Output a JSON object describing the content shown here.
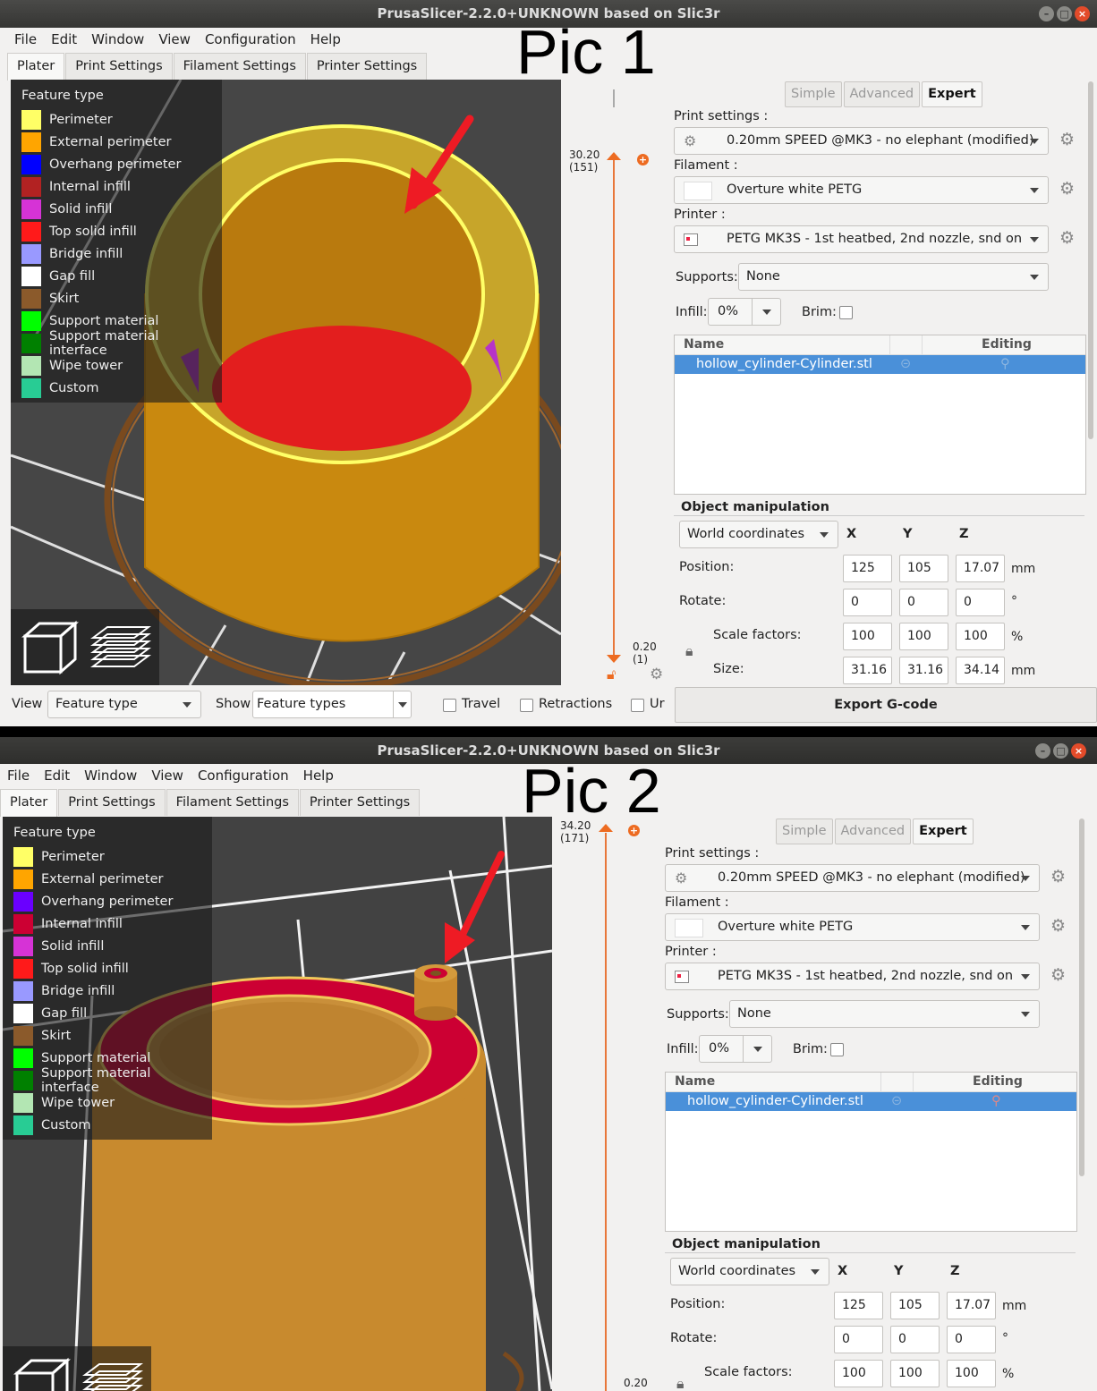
{
  "window": {
    "title": "PrusaSlicer-2.2.0+UNKNOWN based on Slic3r"
  },
  "menu": [
    "File",
    "Edit",
    "Window",
    "View",
    "Configuration",
    "Help"
  ],
  "tabs": [
    "Plater",
    "Print Settings",
    "Filament Settings",
    "Printer Settings"
  ],
  "pic_labels": {
    "pic1": "Pic 1",
    "pic2": "Pic 2"
  },
  "legend": {
    "title": "Feature type",
    "items": [
      {
        "label": "Perimeter",
        "color": "#ffff66"
      },
      {
        "label": "External perimeter",
        "color": "#ffa500"
      },
      {
        "label": "Overhang perimeter",
        "color": "#0000ff"
      },
      {
        "label": "Internal infill",
        "color": "#b22222"
      },
      {
        "label": "Solid infill",
        "color": "#d633d6"
      },
      {
        "label": "Top solid infill",
        "color": "#ff1a1a"
      },
      {
        "label": "Bridge infill",
        "color": "#9999ff"
      },
      {
        "label": "Gap fill",
        "color": "#ffffff"
      },
      {
        "label": "Skirt",
        "color": "#8b5a2b"
      },
      {
        "label": "Support material",
        "color": "#00ff00"
      },
      {
        "label": "Support material interface",
        "color": "#008000"
      },
      {
        "label": "Wipe tower",
        "color": "#b3e6b3"
      },
      {
        "label": "Custom",
        "color": "#28cc94"
      }
    ],
    "pic2_colors": {
      "overhang": "#6a00ff",
      "internal_infill": "#cc0033"
    }
  },
  "slider": {
    "pic1": {
      "top_value": "30.20",
      "top_layer": "(151)",
      "bottom_value": "0.20",
      "bottom_layer": "(1)"
    },
    "pic2": {
      "top_value": "34.20",
      "top_layer": "(171)",
      "bottom_value": "0.20"
    }
  },
  "modes": {
    "simple": "Simple",
    "advanced": "Advanced",
    "expert": "Expert"
  },
  "settings": {
    "print_label": "Print settings :",
    "print_value": "0.20mm SPEED @MK3 - no elephant (modified)",
    "filament_label": "Filament :",
    "filament_value": "Overture white PETG",
    "printer_label": "Printer :",
    "printer_value": "PETG MK3S - 1st heatbed, 2nd nozzle, snd on",
    "supports_label": "Supports:",
    "supports_value": "None",
    "infill_label": "Infill:",
    "infill_value": "0%",
    "brim_label": "Brim:"
  },
  "object_list": {
    "col_name": "Name",
    "col_editing": "Editing",
    "item": "hollow_cylinder-Cylinder.stl"
  },
  "manipulation": {
    "title": "Object manipulation",
    "coord_system": "World coordinates",
    "axes": [
      "X",
      "Y",
      "Z"
    ],
    "position_label": "Position:",
    "position": [
      "125",
      "105",
      "17.07"
    ],
    "position_unit": "mm",
    "rotate_label": "Rotate:",
    "rotate": [
      "0",
      "0",
      "0"
    ],
    "rotate_unit": "°",
    "scale_label": "Scale factors:",
    "scale": [
      "100",
      "100",
      "100"
    ],
    "scale_unit": "%",
    "size_label": "Size:",
    "size": [
      "31.16",
      "31.16",
      "34.14"
    ],
    "size_unit": "mm"
  },
  "bottom": {
    "view_label": "View",
    "view_value": "Feature type",
    "show_label": "Show",
    "show_value": "Feature types",
    "travel": "Travel",
    "retractions": "Retractions",
    "truncated": "Ur",
    "export": "Export G-code"
  },
  "annotation_color": "#ee1b24",
  "accent_color": "#ed6b21"
}
